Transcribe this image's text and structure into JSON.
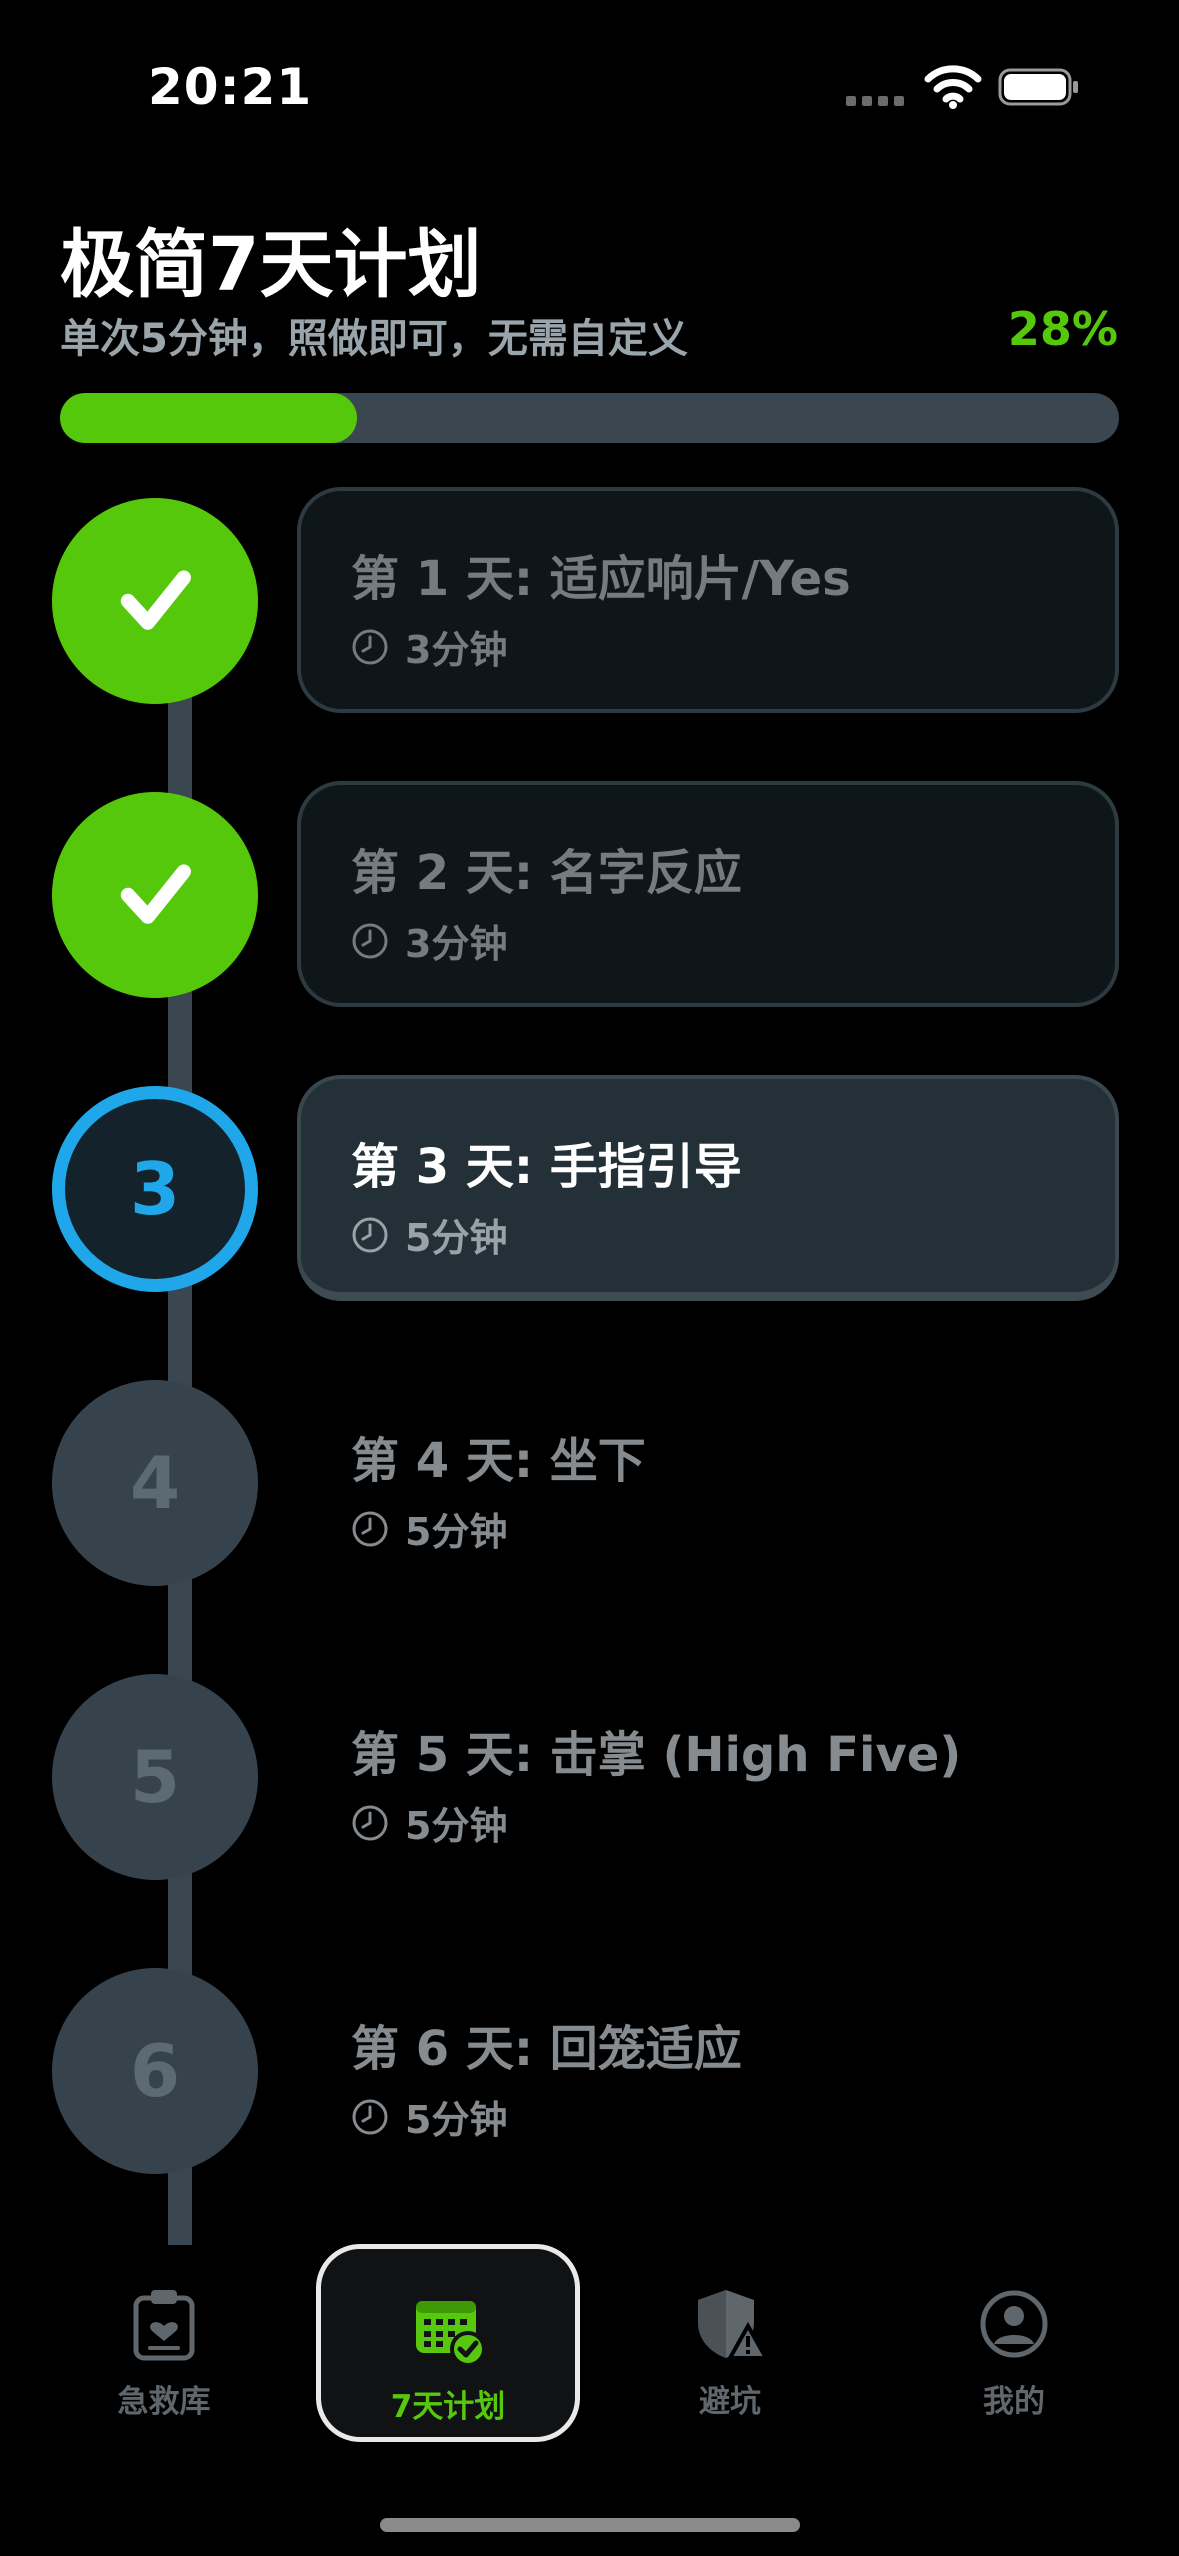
{
  "status_bar": {
    "time": "20:21"
  },
  "header": {
    "title": "极简7天计划",
    "subtitle": "单次5分钟，照做即可，无需自定义",
    "progress_text": "28%",
    "progress_fraction": 0.28
  },
  "colors": {
    "accent_green": "#56c80c",
    "current_blue": "#1fa7ea",
    "track": "#3a4650",
    "background": "#000000"
  },
  "days": [
    {
      "number": "1",
      "title": "第 1 天: 适应响片/Yes",
      "duration": "3分钟",
      "state": "done"
    },
    {
      "number": "2",
      "title": "第 2 天: 名字反应",
      "duration": "3分钟",
      "state": "done"
    },
    {
      "number": "3",
      "title": "第 3 天: 手指引导",
      "duration": "5分钟",
      "state": "current"
    },
    {
      "number": "4",
      "title": "第 4 天: 坐下",
      "duration": "5分钟",
      "state": "todo"
    },
    {
      "number": "5",
      "title": "第 5 天: 击掌 (High Five)",
      "duration": "5分钟",
      "state": "todo"
    },
    {
      "number": "6",
      "title": "第 6 天: 回笼适应",
      "duration": "5分钟",
      "state": "todo"
    }
  ],
  "tabs": [
    {
      "label": "急救库",
      "icon": "clipboard-heart-icon",
      "active": false
    },
    {
      "label": "7天计划",
      "icon": "calendar-check-icon",
      "active": true
    },
    {
      "label": "避坑",
      "icon": "shield-warning-icon",
      "active": false
    },
    {
      "label": "我的",
      "icon": "person-circle-icon",
      "active": false
    }
  ]
}
